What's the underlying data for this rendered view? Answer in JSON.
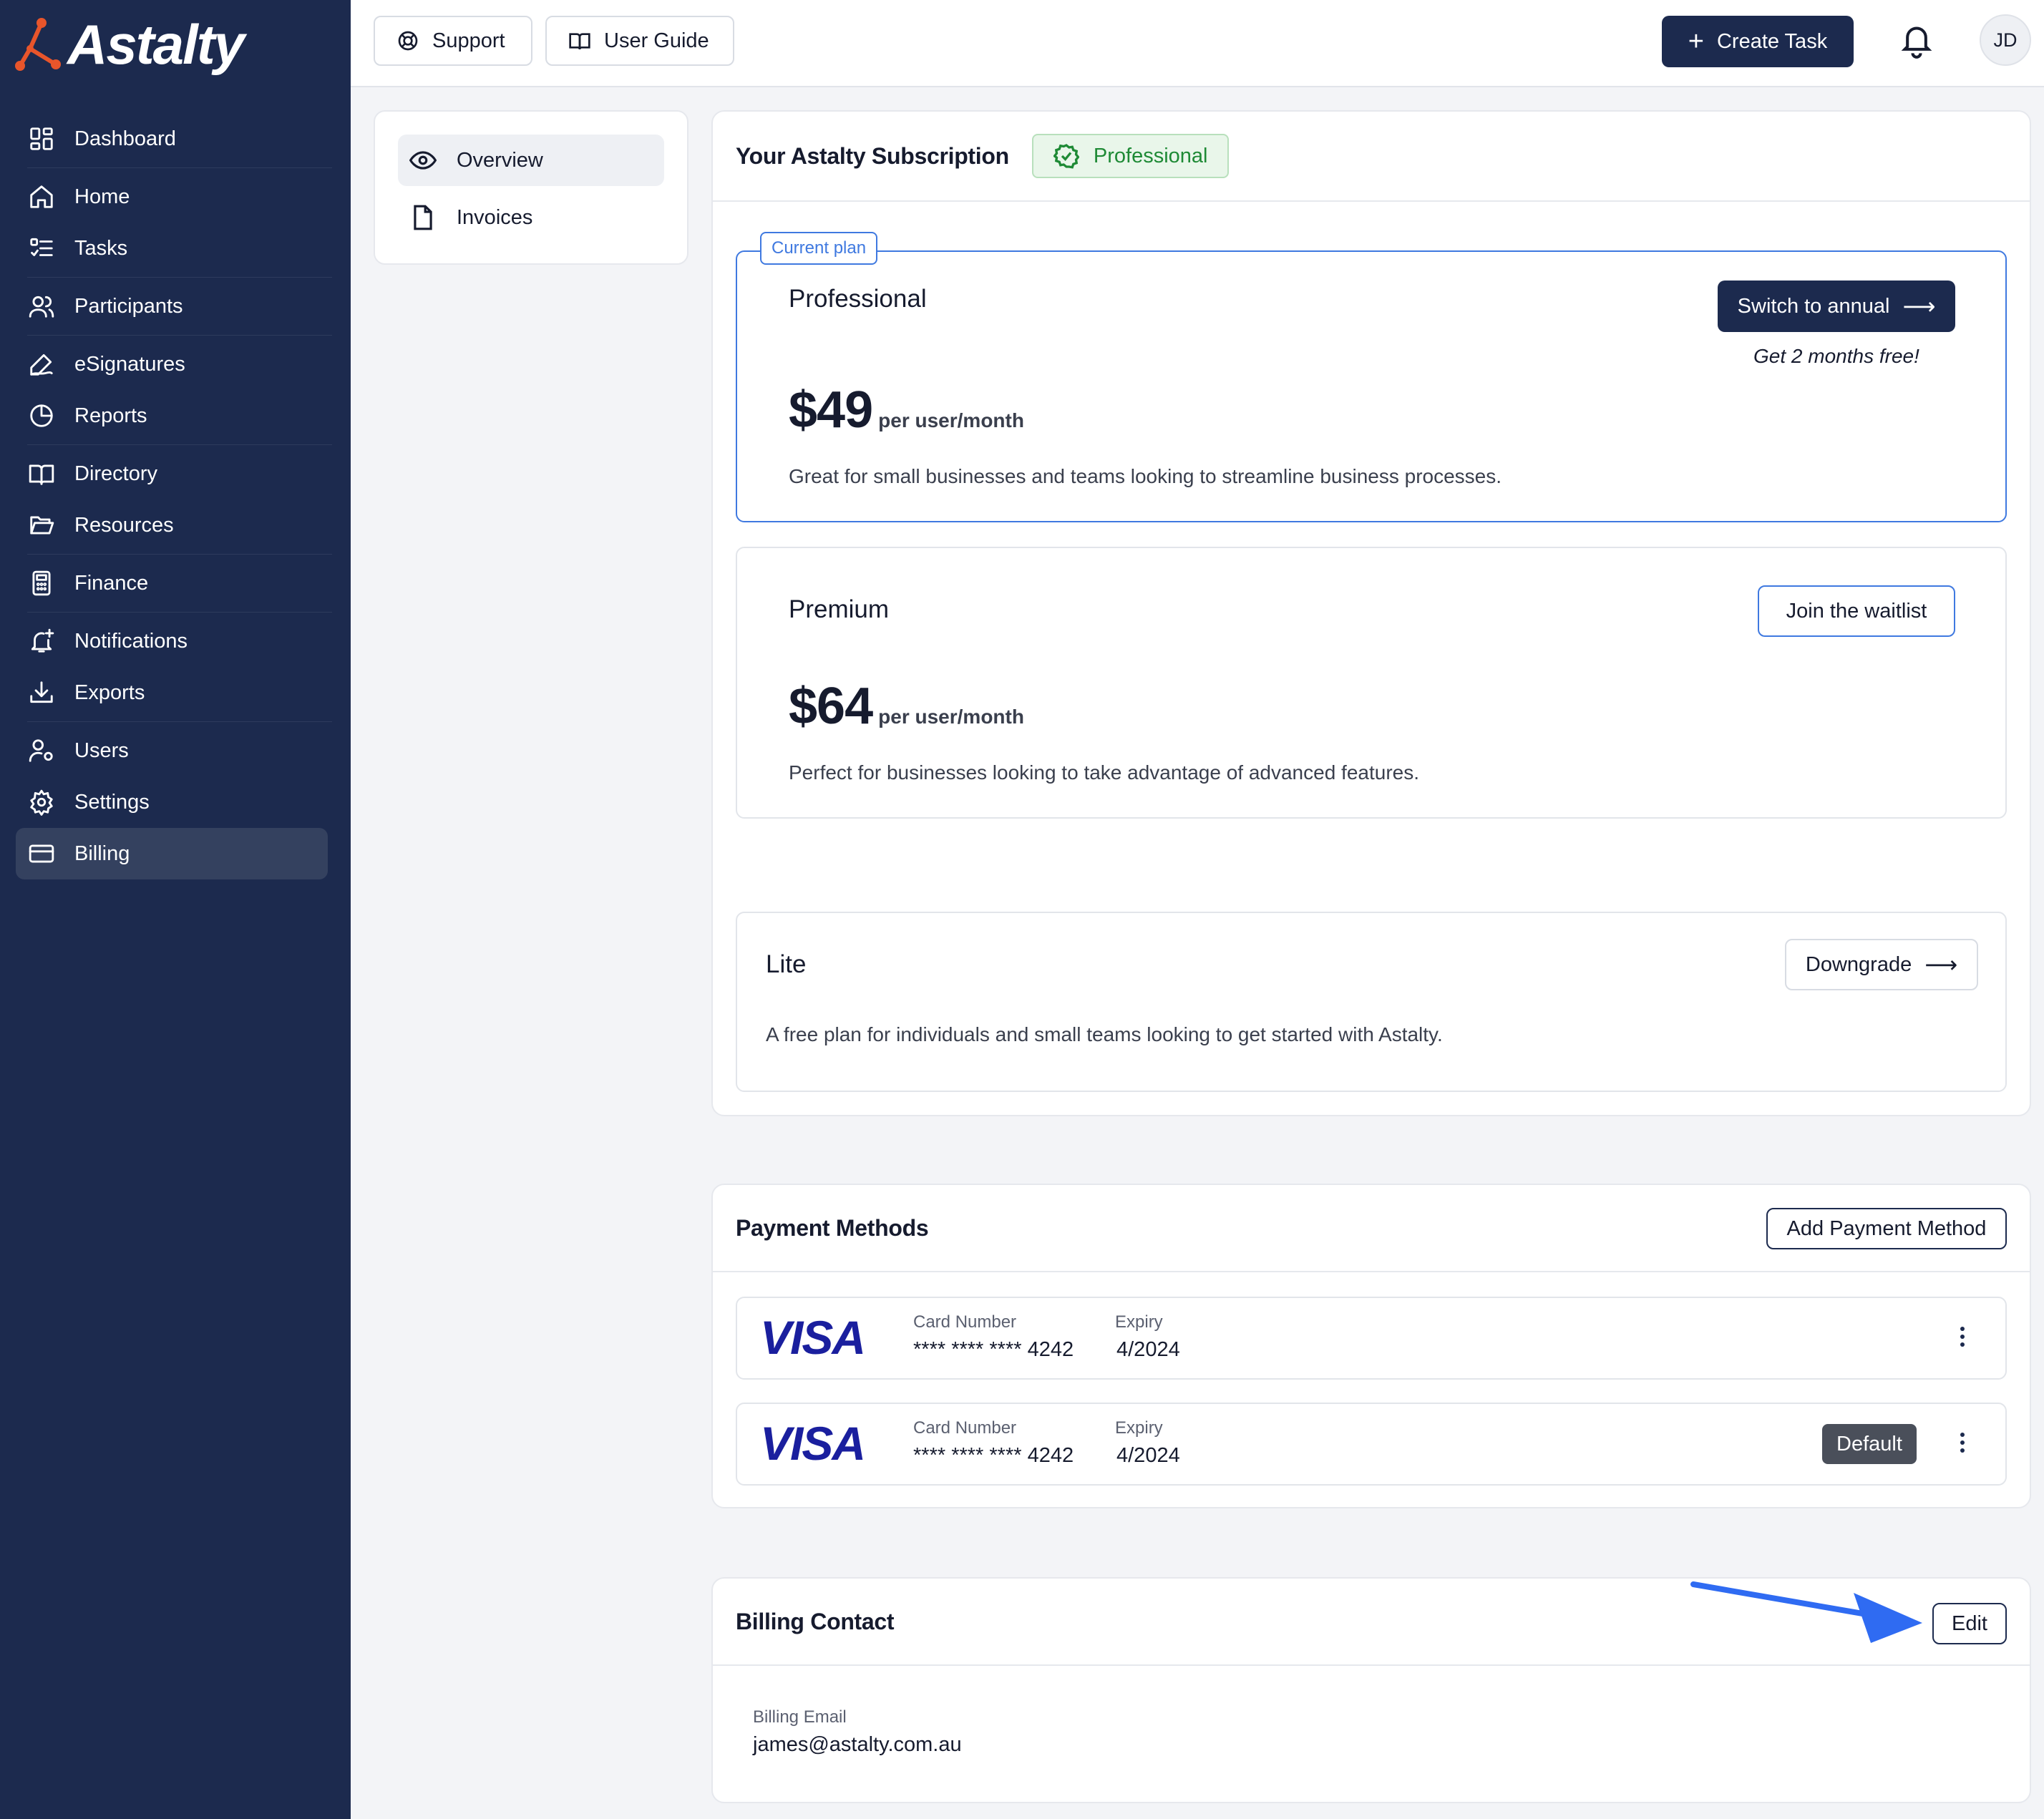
{
  "app": {
    "brand": "Astalty",
    "accent": "#1c2a4e",
    "highlight": "#3f79e0"
  },
  "sidebar": {
    "items": [
      {
        "label": "Dashboard",
        "icon": "dashboard-icon"
      },
      {
        "label": "Home",
        "icon": "home-icon"
      },
      {
        "label": "Tasks",
        "icon": "tasks-icon"
      },
      {
        "label": "Participants",
        "icon": "participants-icon"
      },
      {
        "label": "eSignatures",
        "icon": "signature-icon"
      },
      {
        "label": "Reports",
        "icon": "pie-chart-icon"
      },
      {
        "label": "Directory",
        "icon": "book-icon"
      },
      {
        "label": "Resources",
        "icon": "folder-icon"
      },
      {
        "label": "Finance",
        "icon": "calculator-icon"
      },
      {
        "label": "Notifications",
        "icon": "bell-plus-icon"
      },
      {
        "label": "Exports",
        "icon": "download-icon"
      },
      {
        "label": "Users",
        "icon": "user-gear-icon"
      },
      {
        "label": "Settings",
        "icon": "gear-icon"
      },
      {
        "label": "Billing",
        "icon": "credit-card-icon",
        "active": true
      }
    ]
  },
  "topbar": {
    "support_label": "Support",
    "guide_label": "User Guide",
    "create_label": "Create Task",
    "avatar_initials": "JD"
  },
  "subnav": {
    "items": [
      {
        "label": "Overview",
        "active": true
      },
      {
        "label": "Invoices"
      }
    ]
  },
  "subscription": {
    "title": "Your Astalty Subscription",
    "badge": "Professional",
    "current_tag": "Current plan",
    "plans": {
      "professional": {
        "name": "Professional",
        "price": "$49",
        "per": "per user/month",
        "desc": "Great for small businesses and teams looking to streamline business processes.",
        "button": "Switch to annual",
        "promo": "Get 2 months free!"
      },
      "premium": {
        "name": "Premium",
        "price": "$64",
        "per": "per user/month",
        "desc": "Perfect for businesses looking to take advantage of advanced features.",
        "button": "Join the waitlist"
      },
      "lite": {
        "name": "Lite",
        "desc": "A free plan for individuals and small teams looking to get started with Astalty.",
        "button": "Downgrade"
      }
    }
  },
  "payment": {
    "title": "Payment Methods",
    "add_label": "Add Payment Method",
    "card_number_label": "Card Number",
    "expiry_label": "Expiry",
    "cards": [
      {
        "brand": "VISA",
        "number": "**** **** **** 4242",
        "expiry": "4/2024"
      },
      {
        "brand": "VISA",
        "number": "**** **** **** 4242",
        "expiry": "4/2024",
        "default_label": "Default"
      }
    ]
  },
  "billing_contact": {
    "title": "Billing Contact",
    "edit_label": "Edit",
    "email_label": "Billing Email",
    "email": "james@astalty.com.au"
  }
}
